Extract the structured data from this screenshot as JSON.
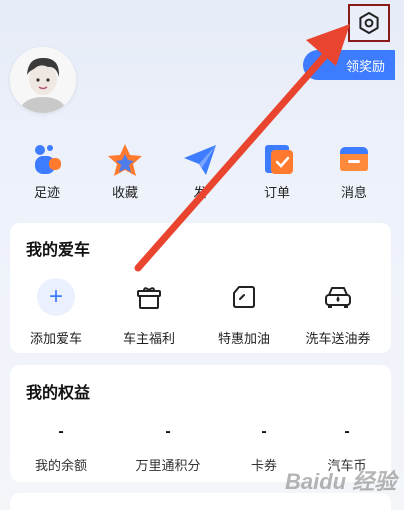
{
  "header": {
    "reward_label": "领奖励"
  },
  "quick_actions": [
    {
      "label": "足迹",
      "icon": "footprint-icon"
    },
    {
      "label": "收藏",
      "icon": "star-icon"
    },
    {
      "label": "发",
      "icon": "send-icon"
    },
    {
      "label": "订单",
      "icon": "order-icon"
    },
    {
      "label": "消息",
      "icon": "message-icon"
    }
  ],
  "my_car": {
    "title": "我的爱车",
    "items": [
      {
        "label": "添加爱车",
        "icon": "plus-icon"
      },
      {
        "label": "车主福利",
        "icon": "gift-icon"
      },
      {
        "label": "特惠加油",
        "icon": "fuel-card-icon"
      },
      {
        "label": "洗车送油券",
        "icon": "car-wash-icon"
      }
    ]
  },
  "my_rights": {
    "title": "我的权益",
    "items": [
      {
        "value": "-",
        "label": "我的余额"
      },
      {
        "value": "-",
        "label": "万里通积分"
      },
      {
        "value": "-",
        "label": "卡券"
      },
      {
        "value": "-",
        "label": "汽车币"
      }
    ]
  },
  "colors": {
    "accent": "#3d7bff",
    "arrow": "#e8442e",
    "highlight_box": "#8b1a1a"
  },
  "watermark": "Baidu 经验"
}
